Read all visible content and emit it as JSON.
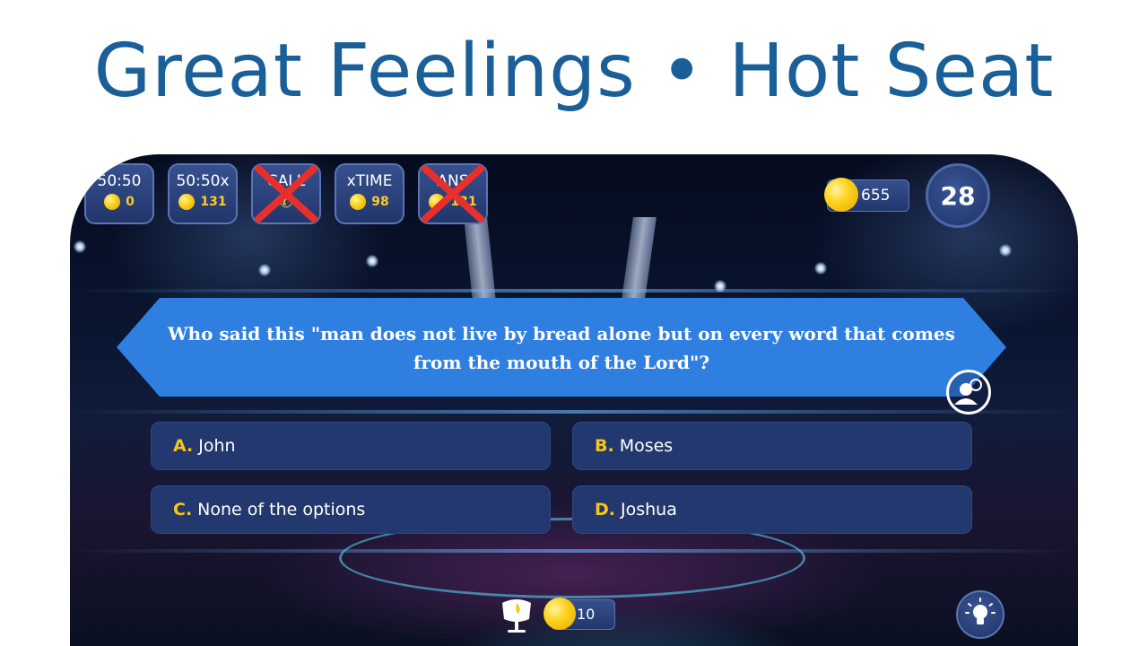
{
  "title": "Great Feelings • Hot Seat",
  "lifelines": [
    {
      "label": "50:50",
      "cost": "0",
      "disabled": false
    },
    {
      "label": "50:50x",
      "cost": "131",
      "disabled": false
    },
    {
      "label": "CALL",
      "cost": "",
      "disabled": true
    },
    {
      "label": "xTIME",
      "cost": "98",
      "disabled": false
    },
    {
      "label": "ANS",
      "cost": "131",
      "disabled": true
    }
  ],
  "coins": "655",
  "timer": "28",
  "question": "Who said this \"man does not live by bread alone but on every word that comes from the mouth of the Lord\"?",
  "answers": [
    {
      "letter": "A.",
      "text": "John"
    },
    {
      "letter": "B.",
      "text": "Moses"
    },
    {
      "letter": "C.",
      "text": "None of the options"
    },
    {
      "letter": "D.",
      "text": "Joshua"
    }
  ],
  "bottom_coins": "10",
  "icons": {
    "audience": "audience-icon",
    "seat": "hot-seat-icon",
    "hint": "lightbulb-icon",
    "call": "phone-icon"
  },
  "colors": {
    "title": "#1a5f98",
    "question_banner": "#2f7fe0",
    "answer_bg": "#22386e",
    "answer_letter": "#f5c518",
    "cross": "#e8302b"
  }
}
